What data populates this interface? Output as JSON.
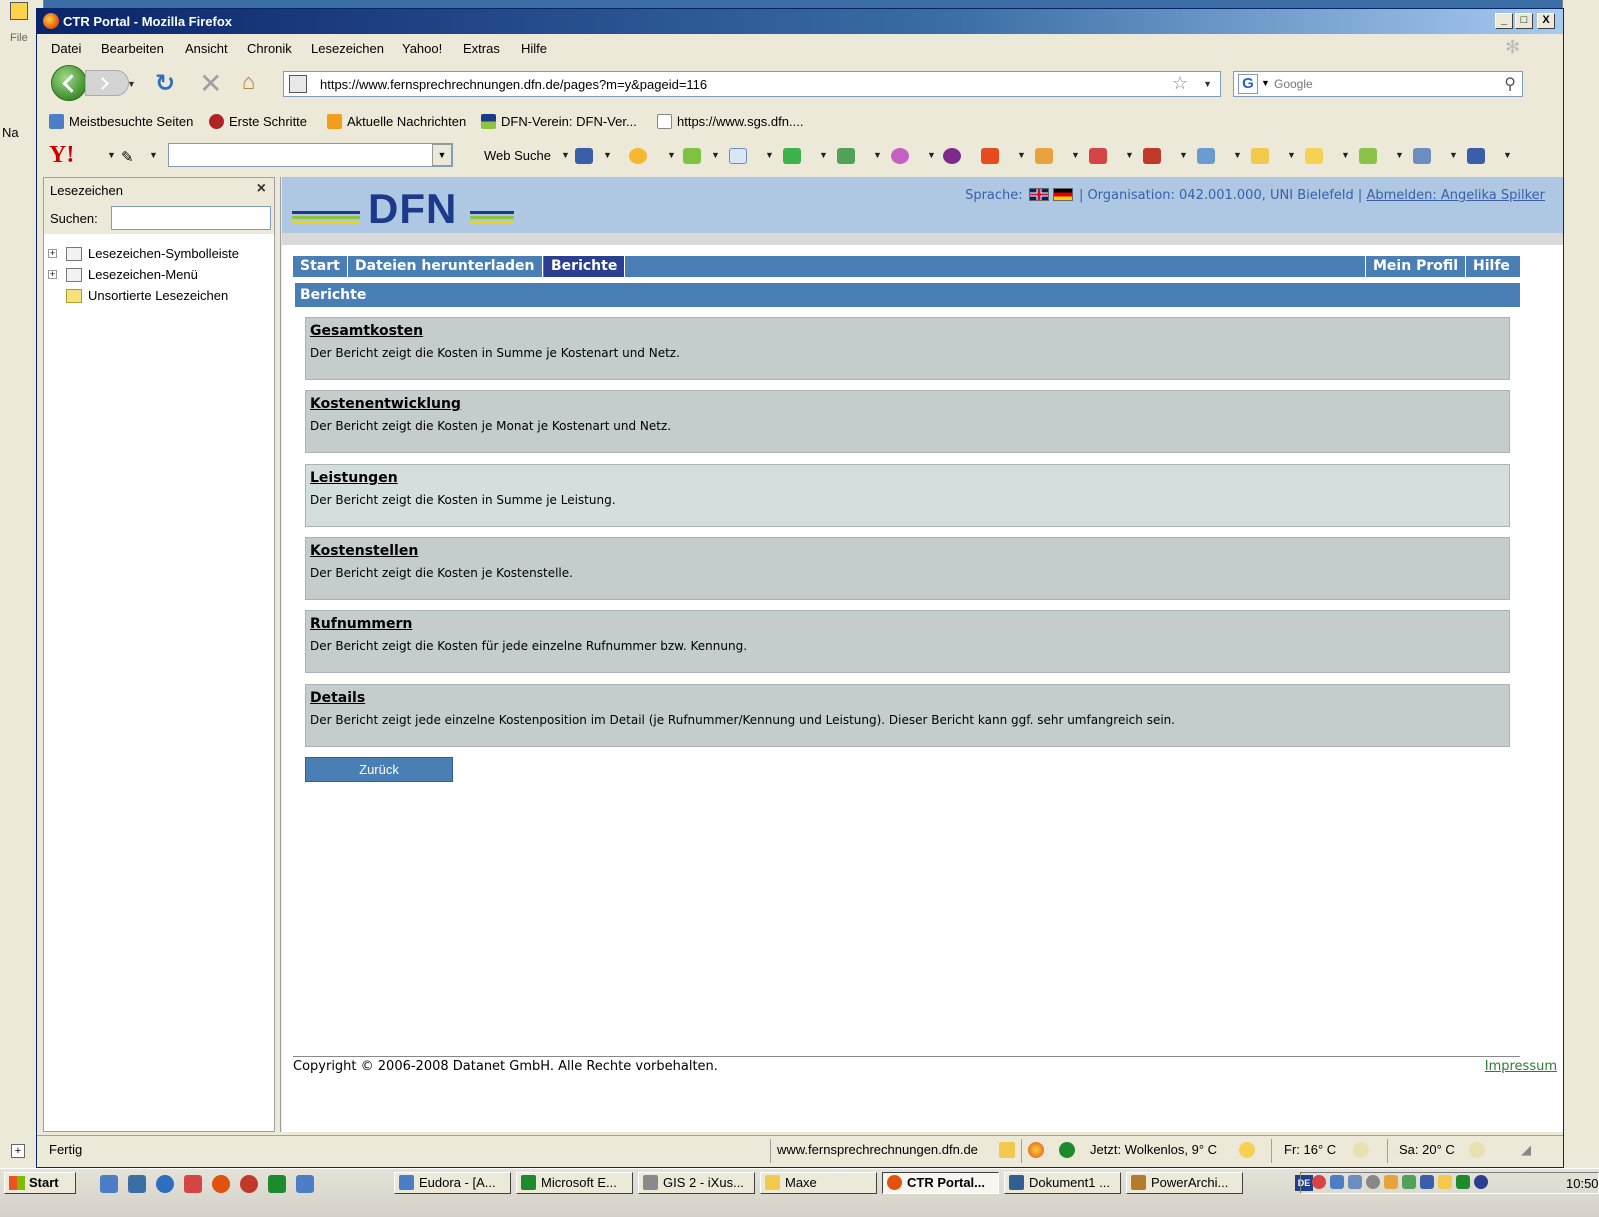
{
  "window": {
    "title": "CTR Portal - Mozilla Firefox",
    "buttons": [
      "_",
      "□",
      "X"
    ]
  },
  "background_app": {
    "menu_label": "File",
    "tab_label": "Na"
  },
  "menu": {
    "items": [
      "Datei",
      "Bearbeiten",
      "Ansicht",
      "Chronik",
      "Lesezeichen",
      "Yahoo!",
      "Extras",
      "Hilfe"
    ]
  },
  "navbar": {
    "url": "https://www.fernsprechrechnungen.dfn.de/pages?m=y&pageid=116",
    "search_placeholder": "Google"
  },
  "bookmarks": {
    "items": [
      "Meistbesuchte Seiten",
      "Erste Schritte",
      "Aktuelle Nachrichten",
      "DFN-Verein: DFN-Ver...",
      "https://www.sgs.dfn...."
    ]
  },
  "yahoo_toolbar": {
    "logo": "Y!",
    "web_search_label": "Web Suche"
  },
  "sidebar": {
    "title": "Lesezeichen",
    "search_label": "Suchen:",
    "tree": [
      "Lesezeichen-Symbolleiste",
      "Lesezeichen-Menü",
      "Unsortierte Lesezeichen"
    ]
  },
  "page": {
    "logo_text": "DFN",
    "language_label": "Sprache:",
    "organisation": "| Organisation: 042.001.000, UNI Bielefeld |",
    "logout": "Abmelden: Angelika Spilker",
    "nav_left": [
      "Start",
      "Dateien herunterladen",
      "Berichte"
    ],
    "nav_right": [
      "Mein Profil",
      "Hilfe"
    ],
    "active_nav": "Berichte",
    "section_title": "Berichte",
    "reports": [
      {
        "title": "Gesamtkosten",
        "desc": "Der Bericht zeigt die Kosten in Summe je Kostenart und Netz."
      },
      {
        "title": "Kostenentwicklung",
        "desc": "Der Bericht zeigt die Kosten je Monat je Kostenart und Netz."
      },
      {
        "title": "Leistungen",
        "desc": "Der Bericht zeigt die Kosten in Summe je Leistung."
      },
      {
        "title": "Kostenstellen",
        "desc": "Der Bericht zeigt die Kosten je Kostenstelle."
      },
      {
        "title": "Rufnummern",
        "desc": "Der Bericht zeigt die Kosten für jede einzelne Rufnummer bzw. Kennung."
      },
      {
        "title": "Details",
        "desc": "Der Bericht zeigt jede einzelne Kostenposition im Detail (je Rufnummer/Kennung und Leistung). Dieser Bericht kann ggf. sehr umfangreich sein."
      }
    ],
    "back_button": "Zurück",
    "copyright": "Copyright © 2006-2008 Datanet GmbH. Alle Rechte vorbehalten.",
    "impressum": "Impressum"
  },
  "statusbar": {
    "status": "Fertig",
    "host": "www.fernsprechrechnungen.dfn.de",
    "weather_now": "Jetzt: Wolkenlos, 9° C",
    "weather_fr": "Fr: 16° C",
    "weather_sa": "Sa: 20° C"
  },
  "taskbar": {
    "start": "Start",
    "tasks": [
      "Eudora - [A...",
      "Microsoft E...",
      "GIS 2 - iXus...",
      "Maxe",
      "CTR Portal...",
      "Dokument1 ...",
      "PowerArchi..."
    ],
    "active_task": "CTR Portal...",
    "lang": "DE",
    "clock": "10:50"
  },
  "colors": {
    "nav_blue": "#4a7fb5",
    "nav_active": "#2a3f8f",
    "header_bg": "#aec7e3",
    "report_bg": "#c4cccc",
    "report_alt_bg": "#d4dede",
    "impressum_green": "#2e7d32"
  }
}
